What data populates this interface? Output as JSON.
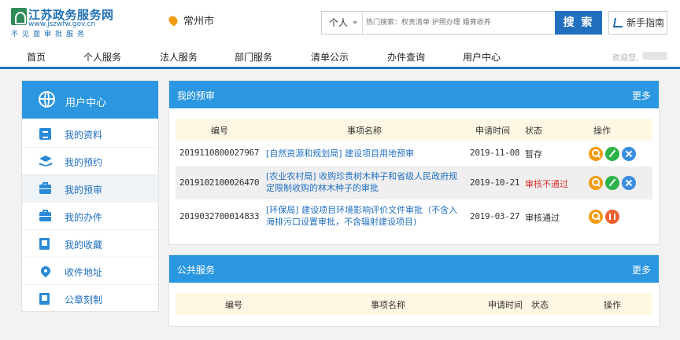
{
  "header": {
    "logo_name": "江苏政务服务网",
    "logo_url": "www.jszwfw.gov.cn",
    "logo_slogan": "不见面审批服务",
    "city": "常州市",
    "search_scope": "个人",
    "search_placeholder": "热门搜索：权责清单 护照办理 婚育收养",
    "search_button": "搜 索",
    "guide_button": "新手指南"
  },
  "nav": {
    "items": [
      "首页",
      "个人服务",
      "法人服务",
      "部门服务",
      "清单公示",
      "办件查询",
      "用户中心"
    ],
    "welcome": "欢迎您,"
  },
  "sidebar": {
    "title": "用户中心",
    "items": [
      {
        "label": "我的资料",
        "icon": "profile-icon"
      },
      {
        "label": "我的预约",
        "icon": "layers-icon"
      },
      {
        "label": "我的预审",
        "icon": "briefcase-icon"
      },
      {
        "label": "我的办件",
        "icon": "briefcase-icon"
      },
      {
        "label": "我的收藏",
        "icon": "file-icon"
      },
      {
        "label": "收件地址",
        "icon": "location-icon"
      },
      {
        "label": "公章刻制",
        "icon": "file-icon"
      }
    ],
    "active_index": 2
  },
  "prereview": {
    "title": "我的预审",
    "more": "更多",
    "columns": [
      "编号",
      "事项名称",
      "申请时间",
      "状态",
      "操作"
    ],
    "rows": [
      {
        "no": "2019110800027967",
        "name": "[自然资源和规划局] 建设项目用地预审",
        "date": "2019-11-08",
        "status": "暂存"
      },
      {
        "no": "2019102100026470",
        "name": "[农业农村局] 收购珍贵树木种子和省级人民政府规定限制收购的林木种子的审批",
        "date": "2019-10-21",
        "status": "审核不通过"
      },
      {
        "no": "2019032700014833",
        "name": "[环保局] 建设项目环境影响评价文件审批（不含入海排污口设置审批，不含辐射建设项目)",
        "date": "2019-03-27",
        "status": "审核通过"
      }
    ]
  },
  "public_service": {
    "title": "公共服务",
    "more": "更多",
    "columns": [
      "编号",
      "事项名称",
      "申请时间",
      "状态",
      "操作"
    ]
  },
  "colors": {
    "primary": "#2170c0",
    "panel_header": "#2b97e0",
    "status_fail": "#e03030",
    "table_header_bg": "#fdf7e3"
  }
}
